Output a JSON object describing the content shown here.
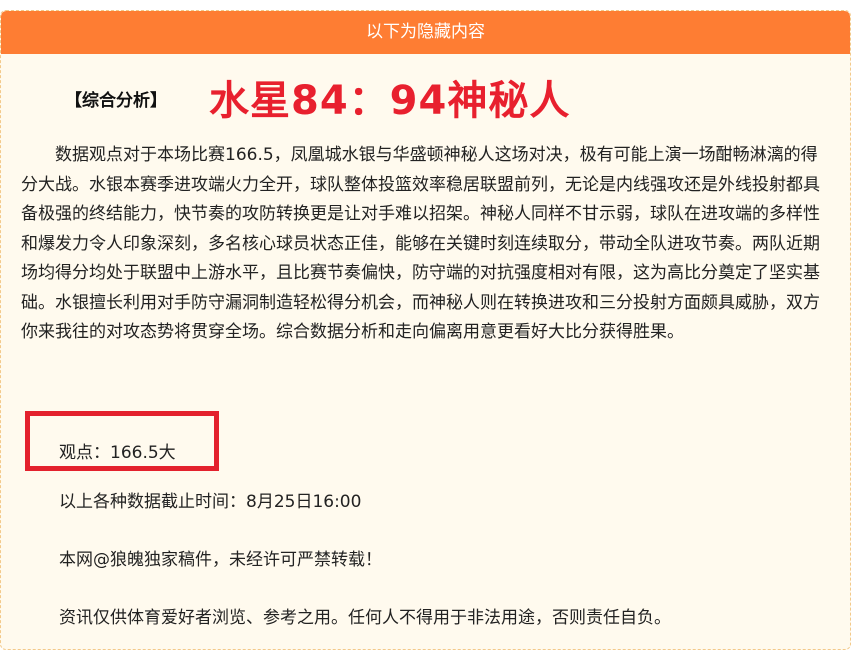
{
  "header": {
    "title": "以下为隐藏内容"
  },
  "analysis": {
    "section_label": "【综合分析】",
    "headline": "水星84：94神秘人",
    "body": "数据观点对于本场比赛166.5，凤凰城水银与华盛顿神秘人这场对决，极有可能上演一场酣畅淋漓的得分大战。水银本赛季进攻端火力全开，球队整体投篮效率稳居联盟前列，无论是内线强攻还是外线投射都具备极强的终结能力，快节奏的攻防转换更是让对手难以招架。神秘人同样不甘示弱，球队在进攻端的多样性和爆发力令人印象深刻，多名核心球员状态正佳，能够在关键时刻连续取分，带动全队进攻节奏。两队近期场均得分均处于联盟中上游水平，且比赛节奏偏快，防守端的对抗强度相对有限，这为高比分奠定了坚实基础。水银擅长利用对手防守漏洞制造轻松得分机会，而神秘人则在转换进攻和三分投射方面颇具威胁，双方你来我往的对攻态势将贯穿全场。综合数据分析和走向偏离用意更看好大比分获得胜果。"
  },
  "viewpoint": {
    "text": "观点：166.5大"
  },
  "footer": {
    "cutoff": "以上各种数据截止时间：8月25日16:00",
    "copyright": "本网@狼魄独家稿件，未经许可严禁转载！",
    "disclaimer": "资讯仅供体育爱好者浏览、参考之用。任何人不得用于非法用途，否则责任自负。"
  },
  "colors": {
    "header_bg": "#fe7d33",
    "headline": "#e8202e",
    "highlight_border": "#e3212d",
    "panel_bg": "#fffaee"
  }
}
